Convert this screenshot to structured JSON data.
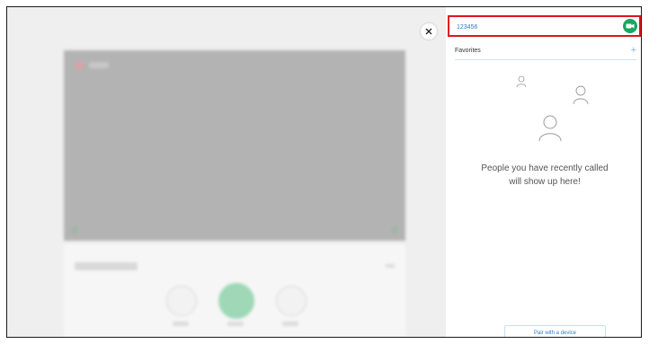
{
  "dialpad": {
    "number_value": "123456",
    "call_icon": "video-call-icon"
  },
  "close_icon": "close-icon",
  "favorites": {
    "label": "Favorites",
    "add_label": "+"
  },
  "empty_state": {
    "line1": "People you have recently called",
    "line2": "will show up here!"
  },
  "pair_button": {
    "label": "Pair with a device"
  },
  "colors": {
    "accent": "#2f7bc8",
    "call_green": "#16a85e",
    "highlight_red": "#e0141e"
  }
}
